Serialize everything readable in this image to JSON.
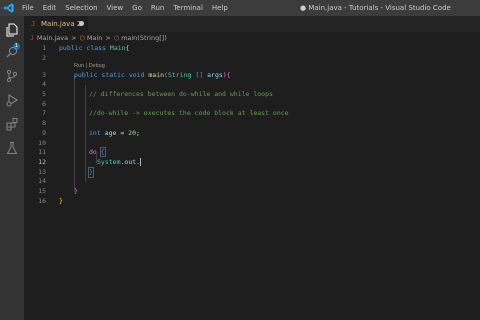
{
  "titlebar": {
    "menu": [
      "File",
      "Edit",
      "Selection",
      "View",
      "Go",
      "Run",
      "Terminal",
      "Help"
    ],
    "title": "● Main.java - Tutorials - Visual Studio Code"
  },
  "activity": {
    "icons": [
      "files-icon",
      "search-icon",
      "source-control-icon",
      "run-debug-icon",
      "extensions-icon",
      "testing-icon"
    ],
    "explorer_badge": "1"
  },
  "tab": {
    "icon": "J",
    "label": "Main.java 2"
  },
  "breadcrumb": {
    "icon": "J",
    "file": "Main.java",
    "sep1": ">",
    "class_icon": "⬡",
    "class": "Main",
    "sep2": ">",
    "method_icon": "⬡",
    "method": "main(String[])"
  },
  "editor": {
    "codelens": "Run | Debug",
    "line_numbers": [
      "1",
      "2",
      "3",
      "4",
      "5",
      "6",
      "7",
      "8",
      "9",
      "10",
      "11",
      "12",
      "13",
      "14",
      "15",
      "16"
    ],
    "lines": {
      "l1_kw1": "public",
      "l1_kw2": "class",
      "l1_name": "Main",
      "l1_br": "{",
      "l3_kw1": "public",
      "l3_kw2": "static",
      "l3_kw3": "void",
      "l3_fn": "main",
      "l3_p1": "(",
      "l3_ty": "String",
      "l3_arr": "[]",
      "l3_var": "args",
      "l3_p2": ")",
      "l3_br": "{",
      "l5_comment": "// differences between do-while and while loops",
      "l7_comment": "//do-while -> executes the code block at least once",
      "l9_kw": "int",
      "l9_var": "age",
      "l9_op": " = ",
      "l9_num": "20",
      "l9_end": ";",
      "l11_kw": "do",
      "l11_br": "{",
      "l12_cls": "System",
      "l12_dot1": ".",
      "l12_fld": "out",
      "l12_dot2": ".",
      "l13_br": "}",
      "l15_br": "}",
      "l16_br": "}"
    }
  }
}
